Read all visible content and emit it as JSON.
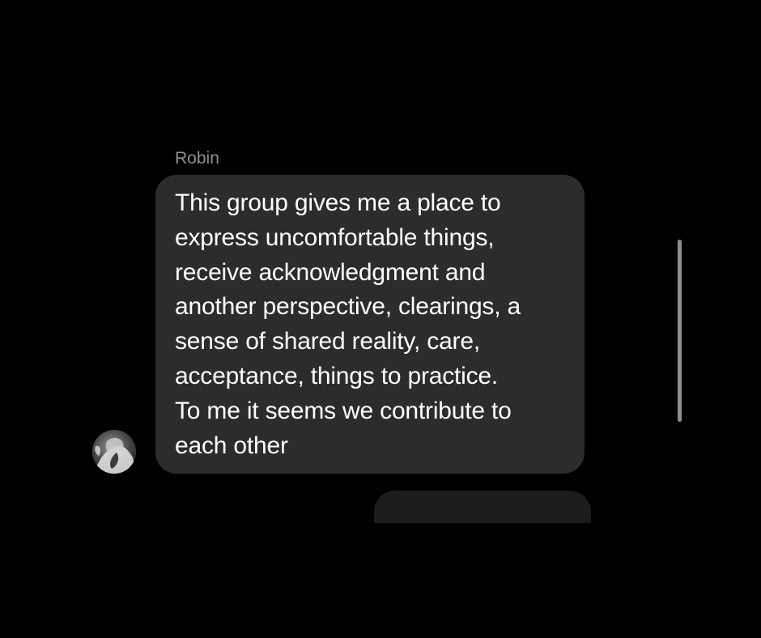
{
  "conversation": {
    "message": {
      "sender": "Robin",
      "text": "This group gives me a place to\nexpress uncomfortable things,\nreceive acknowledgment and\nanother perspective, clearings, a\nsense of shared reality, care,\nacceptance, things to practice.\nTo me it seems we contribute to\neach other"
    },
    "avatar_icon": "user-avatar-photo"
  },
  "colors": {
    "background": "#000000",
    "bubble": "#2c2c2e",
    "sender_text": "#8e8e93",
    "message_text": "#ffffff",
    "scrollbar": "#8e8e93"
  }
}
